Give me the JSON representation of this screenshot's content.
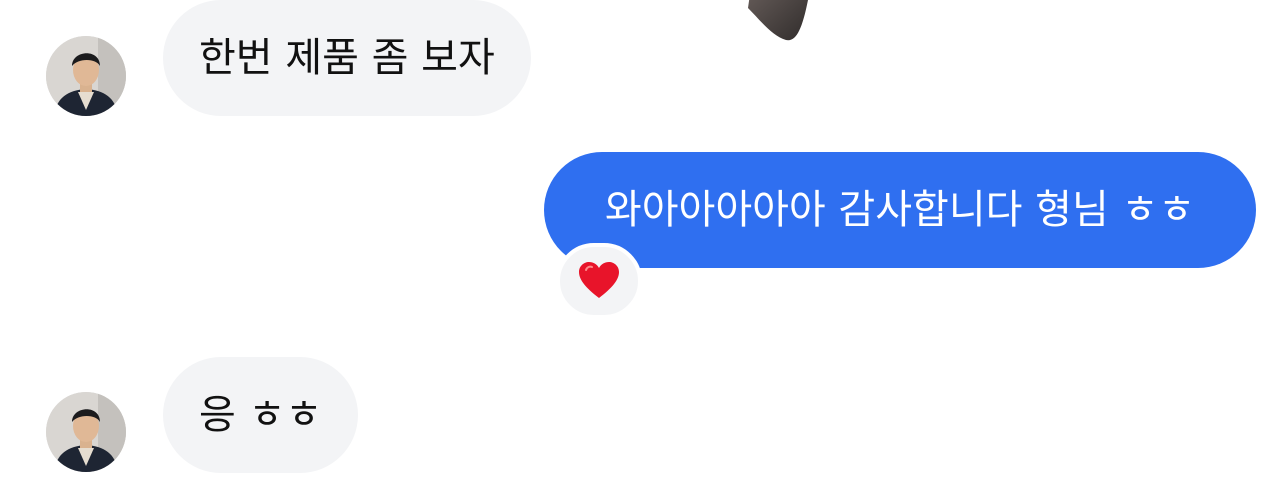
{
  "messages": [
    {
      "direction": "incoming",
      "text": "한번 제품 좀 보자"
    },
    {
      "direction": "outgoing",
      "text": "와아아아아아 감사합니다 형님 ㅎㅎ",
      "reaction": "heart"
    },
    {
      "direction": "incoming",
      "text": "응 ㅎㅎ"
    }
  ],
  "colors": {
    "incoming_bubble": "#f3f4f6",
    "outgoing_bubble": "#2f6ff0",
    "reaction_heart": "#e8142a"
  },
  "icons": {
    "reaction": "heart-icon"
  }
}
